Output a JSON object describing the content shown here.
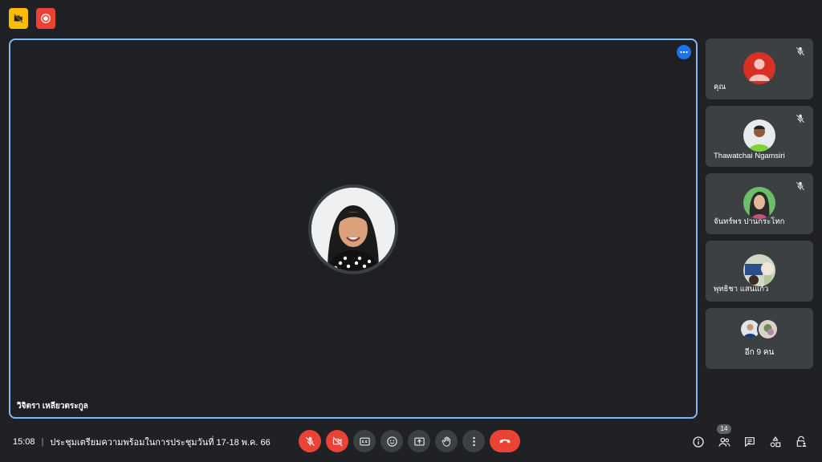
{
  "indicators": {
    "camera_off_icon": "camera-off-icon",
    "recording_icon": "recording-icon"
  },
  "main_tile": {
    "participant_name": "วิจิตรา เหลียวตระกูล",
    "more_icon": "more-horiz-icon"
  },
  "participants": [
    {
      "name": "คุณ",
      "muted": true,
      "avatar": "default-person-avatar",
      "avatar_bg": "#d93025"
    },
    {
      "name": "Thawatchai Ngamsiri",
      "muted": true,
      "avatar": "photo-avatar"
    },
    {
      "name": "จันทร์พร ปานกระโทก",
      "muted": true,
      "avatar": "photo-avatar"
    },
    {
      "name": "พุทธิชา แสนแก้ว",
      "muted": false,
      "avatar": "photo-avatar"
    }
  ],
  "more_participants": {
    "label": "อีก 9 คน"
  },
  "meeting": {
    "time": "15:08",
    "separator": "|",
    "title": "ประชุมเตรียมความพร้อมในการประชุมวันที่ 17-18 พ.ค. 66"
  },
  "controls": [
    {
      "name": "microphone-off-button",
      "icon": "mic-off-icon"
    },
    {
      "name": "camera-off-button",
      "icon": "videocam-off-icon"
    },
    {
      "name": "captions-button",
      "icon": "closed-caption-icon"
    },
    {
      "name": "reactions-button",
      "icon": "emoji-icon"
    },
    {
      "name": "present-screen-button",
      "icon": "present-icon"
    },
    {
      "name": "raise-hand-button",
      "icon": "hand-icon"
    },
    {
      "name": "more-options-button",
      "icon": "more-vert-icon"
    },
    {
      "name": "leave-call-button",
      "icon": "call-end-icon"
    }
  ],
  "right_tools": {
    "people_count": "14"
  },
  "colors": {
    "background": "#202124",
    "tile": "#3c4043",
    "active_border": "#8ab4f8",
    "danger": "#ea4335",
    "warning": "#fbbc04",
    "accent": "#1a73e8"
  }
}
